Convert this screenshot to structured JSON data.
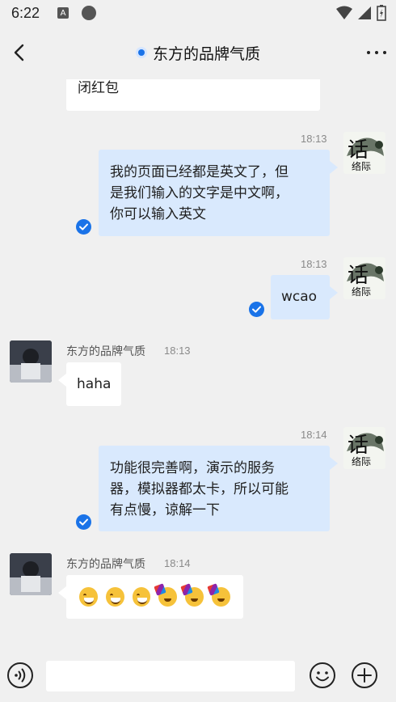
{
  "status_bar": {
    "time": "6:22",
    "a_icon": "A"
  },
  "header": {
    "title": "东方的品牌气质",
    "back_icon": "chevron-left-icon",
    "more_icon": "more-dots-icon"
  },
  "colors": {
    "accent": "#1a73e8",
    "outgoing_bubble": "#d9e9fd",
    "incoming_bubble": "#ffffff",
    "background": "#f0f0f0"
  },
  "messages": [
    {
      "direction": "in",
      "text": "闭红包"
    },
    {
      "direction": "out",
      "time": "18:13",
      "text": "我的页面已经都是英文了，但是我们输入的文字是中文啊，你可以输入英文",
      "line1": "我的页面已经都是英文了，但",
      "line2": "是我们输入的文字是中文啊，",
      "line3": "你可以输入英文",
      "read": true
    },
    {
      "direction": "out",
      "time": "18:13",
      "text": "wcao",
      "read": true
    },
    {
      "direction": "in",
      "sender": "东方的品牌气质",
      "time": "18:13",
      "text": "haha"
    },
    {
      "direction": "out",
      "time": "18:14",
      "text": "功能很完善啊，演示的服务器，模拟器都太卡，所以可能有点慢，谅解一下",
      "line1": "功能很完善啊，演示的服务",
      "line2": "器，模拟器都太卡，所以可能",
      "line3": "有点慢，谅解一下",
      "read": true
    },
    {
      "direction": "in",
      "sender": "东方的品牌气质",
      "time": "18:14",
      "emojis": [
        "grinning-face",
        "grinning-face",
        "grinning-face",
        "partying-face",
        "partying-face",
        "partying-face"
      ]
    }
  ],
  "my_avatar_text": {
    "top": "话",
    "bottom": "络际"
  },
  "input_bar": {
    "placeholder": "",
    "voice_icon": "voice-icon",
    "emoji_icon": "smiley-icon",
    "plus_icon": "plus-circle-icon"
  }
}
